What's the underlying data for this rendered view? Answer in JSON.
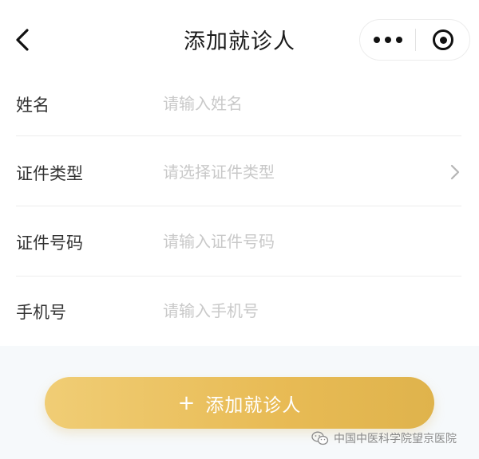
{
  "nav": {
    "title": "添加就诊人",
    "back_icon": "chevron-left-icon",
    "more_icon": "more-dots-icon",
    "close_icon": "target-close-icon"
  },
  "form": {
    "fields": [
      {
        "label": "姓名",
        "placeholder": "请输入姓名",
        "type": "text"
      },
      {
        "label": "证件类型",
        "placeholder": "请选择证件类型",
        "type": "select"
      },
      {
        "label": "证件号码",
        "placeholder": "请输入证件号码",
        "type": "text"
      },
      {
        "label": "手机号",
        "placeholder": "请输入手机号",
        "type": "text"
      }
    ]
  },
  "action": {
    "plus": "+",
    "label": "添加就诊人",
    "color": "#e8bb55"
  },
  "watermark": {
    "text": "中国中医科学院望京医院",
    "icon": "wechat-icon"
  }
}
